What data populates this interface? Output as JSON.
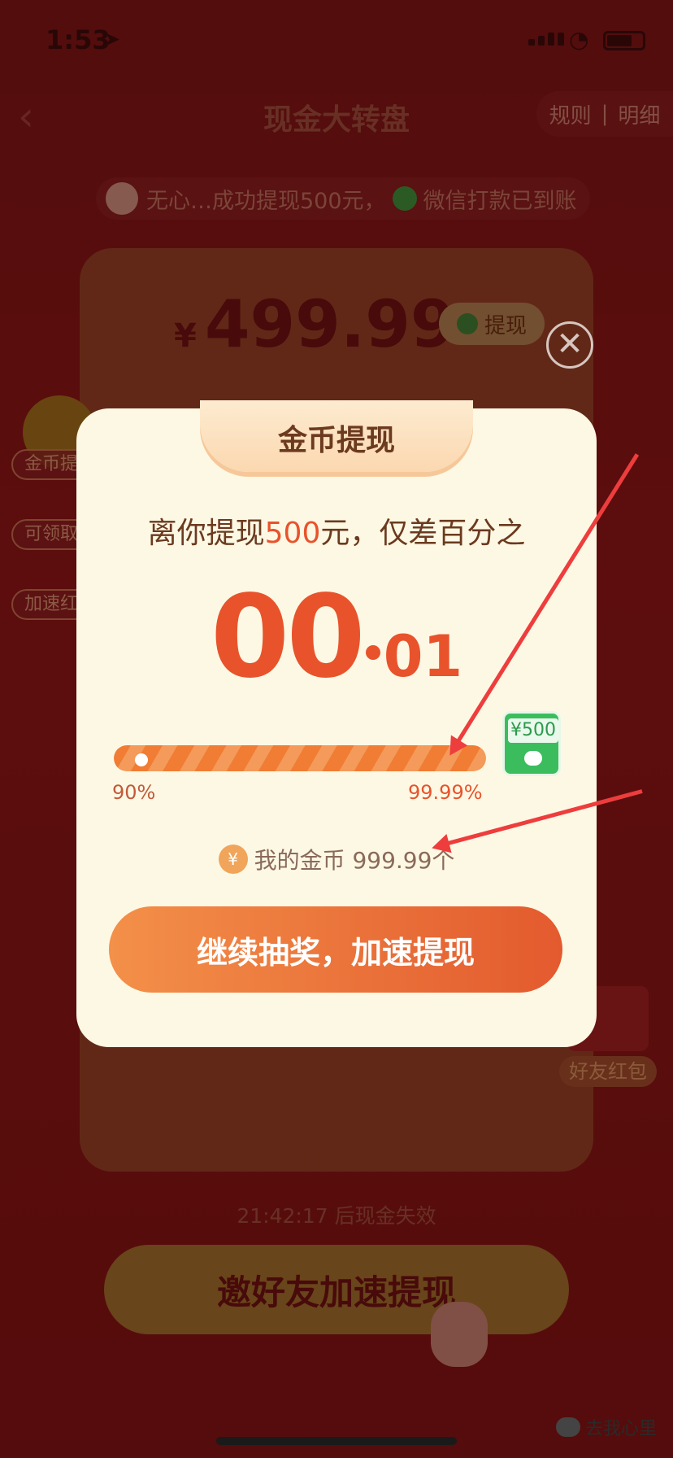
{
  "status_bar": {
    "time": "1:53",
    "location_glyph": "➤",
    "wifi_glyph": "◔"
  },
  "nav": {
    "back_glyph": "‹",
    "title": "现金大转盘",
    "rules": "规则",
    "separator": "|",
    "details": "明细"
  },
  "ticker": {
    "text_a": "无心…成功提现500元，",
    "text_b": "微信打款已到账"
  },
  "balance": {
    "currency": "¥",
    "amount": "499.99",
    "withdraw_label": "提现"
  },
  "side_left": {
    "coin_label": "金币提",
    "claim_label": "可领取",
    "speed_label": "加速红"
  },
  "friend_pack": {
    "label": "好友红包"
  },
  "countdown": "21:42:17 后现金失效",
  "invite_button": "邀好友加速提现",
  "modal": {
    "close_glyph": "✕",
    "title": "金币提现",
    "sub_prefix": "离你提现",
    "sub_amount": "500",
    "sub_suffix": "元，仅差百分之",
    "big_int": "00",
    "big_dec": "01",
    "progress": {
      "percent_filled": 99.99,
      "start_label": "90%",
      "end_label": "99.99%"
    },
    "reward_badge": "¥500",
    "coins_icon": "¥",
    "coins_text": "我的金币 999.99个",
    "continue_button": "继续抽奖，加速提现"
  },
  "watermark": "去我心里",
  "colors": {
    "accent": "#e8532c",
    "modal_bg": "#fdf8e4",
    "arrow": "#ee3d3d",
    "wechat_green": "#3bbd5e"
  }
}
